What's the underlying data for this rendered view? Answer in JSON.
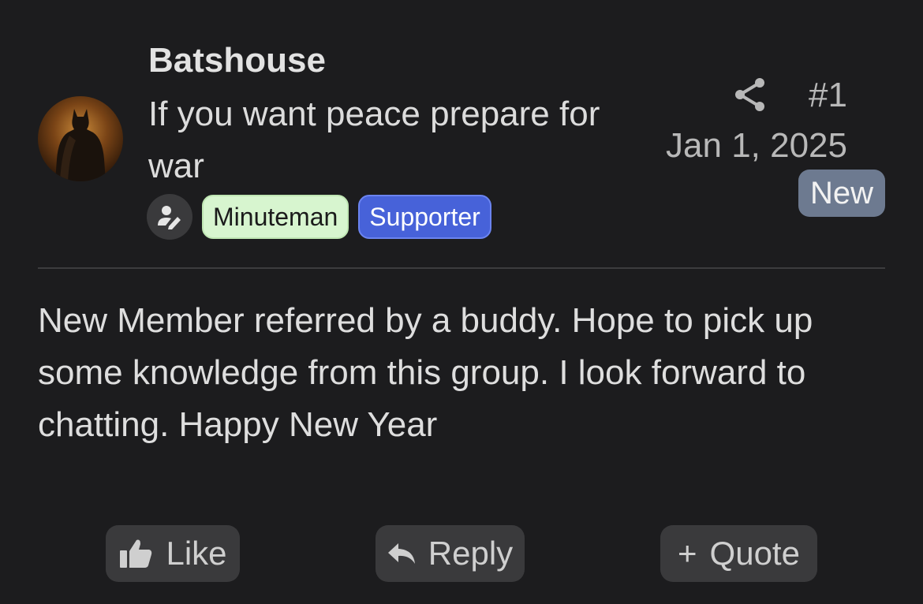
{
  "post": {
    "author": {
      "username": "Batshouse",
      "title": "If you want peace prepare for war",
      "avatar_icon": "user-avatar",
      "banners": [
        "Minuteman",
        "Supporter"
      ]
    },
    "meta": {
      "number": "#1",
      "date": "Jan 1, 2025",
      "new_label": "New"
    },
    "body": "New Member referred by a buddy. Hope to pick up some knowledge from this group. I look forward to chatting. Happy New Year"
  },
  "actions": {
    "like_label": "Like",
    "reply_label": "Reply",
    "quote_label": "Quote",
    "quote_prefix": "+"
  },
  "colors": {
    "background": "#1c1c1e",
    "minuteman_banner": "#d7f5cf",
    "supporter_banner": "#4762d9",
    "new_badge": "#6d7a90",
    "button": "#3a3a3c"
  }
}
